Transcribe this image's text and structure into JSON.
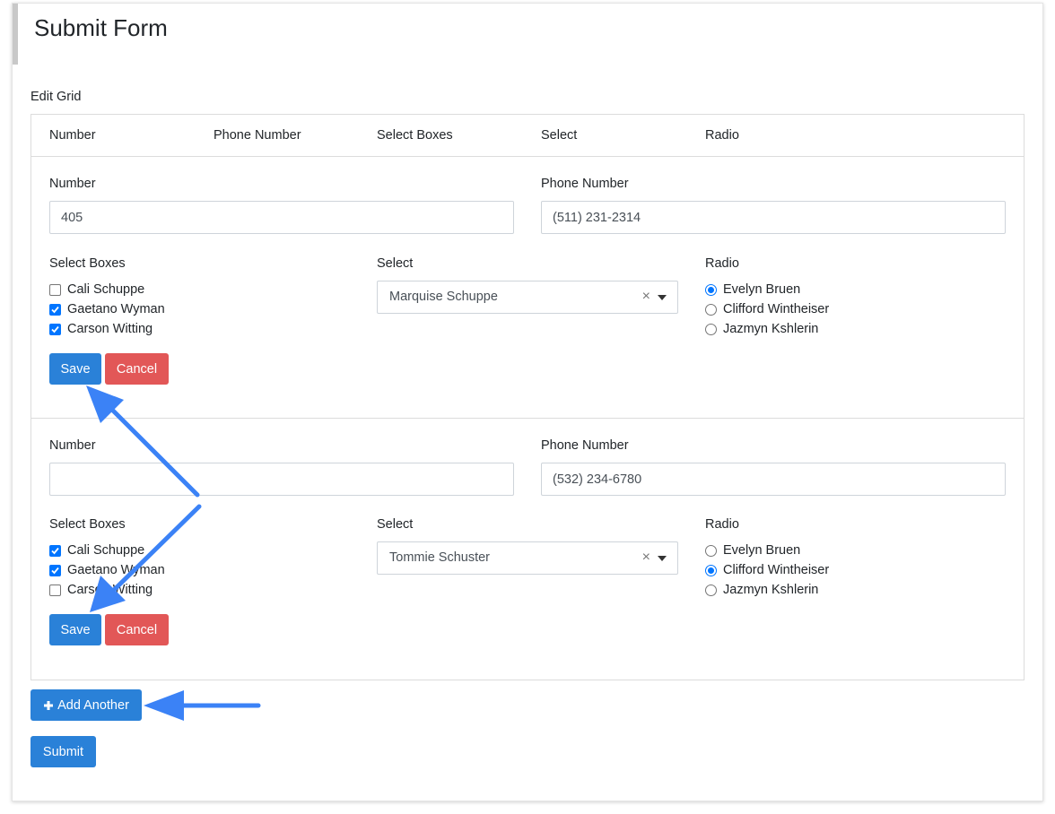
{
  "page": {
    "title": "Submit Form"
  },
  "edit_grid": {
    "label": "Edit Grid",
    "headers": [
      "Number",
      "Phone Number",
      "Select Boxes",
      "Select",
      "Radio"
    ],
    "rows": [
      {
        "number_label": "Number",
        "number_value": "405",
        "phone_label": "Phone Number",
        "phone_value": "(511) 231-2314",
        "select_boxes_label": "Select Boxes",
        "select_boxes": [
          {
            "label": "Cali Schuppe",
            "checked": false
          },
          {
            "label": "Gaetano Wyman",
            "checked": true
          },
          {
            "label": "Carson Witting",
            "checked": true
          }
        ],
        "select_label": "Select",
        "select_value": "Marquise Schuppe",
        "radio_label": "Radio",
        "radios": [
          {
            "label": "Evelyn Bruen",
            "selected": true
          },
          {
            "label": "Clifford Wintheiser",
            "selected": false
          },
          {
            "label": "Jazmyn Kshlerin",
            "selected": false
          }
        ],
        "save_label": "Save",
        "cancel_label": "Cancel"
      },
      {
        "number_label": "Number",
        "number_value": "",
        "phone_label": "Phone Number",
        "phone_value": "(532) 234-6780",
        "select_boxes_label": "Select Boxes",
        "select_boxes": [
          {
            "label": "Cali Schuppe",
            "checked": true
          },
          {
            "label": "Gaetano Wyman",
            "checked": true
          },
          {
            "label": "Carson Witting",
            "checked": false
          }
        ],
        "select_label": "Select",
        "select_value": "Tommie Schuster",
        "radio_label": "Radio",
        "radios": [
          {
            "label": "Evelyn Bruen",
            "selected": false
          },
          {
            "label": "Clifford Wintheiser",
            "selected": true
          },
          {
            "label": "Jazmyn Kshlerin",
            "selected": false
          }
        ],
        "save_label": "Save",
        "cancel_label": "Cancel"
      }
    ],
    "add_another_label": "Add Another",
    "clear_glyph": "×"
  },
  "submit_label": "Submit",
  "colors": {
    "primary": "#2a81d8",
    "danger": "#e25757",
    "annotation_arrow": "#3b82f6",
    "check_blue": "#0075ff"
  },
  "icons": {
    "add": "plus-icon",
    "clear": "clear-icon",
    "dropdown": "caret-down-icon"
  }
}
